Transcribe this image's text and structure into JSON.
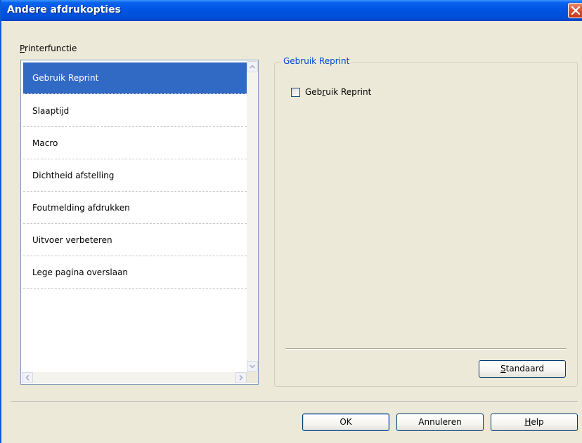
{
  "window": {
    "title": "Andere afdrukopties",
    "close_icon": "close-icon"
  },
  "printer_function": {
    "label_prefix": "P",
    "label_rest": "rinterfunctie",
    "items": [
      {
        "label": "Gebruik Reprint",
        "selected": true
      },
      {
        "label": "Slaaptijd"
      },
      {
        "label": "Macro"
      },
      {
        "label": "Dichtheid afstelling"
      },
      {
        "label": "Foutmelding afdrukken"
      },
      {
        "label": "Uitvoer verbeteren"
      },
      {
        "label": "Lege pagina overslaan"
      }
    ]
  },
  "group": {
    "legend": "Gebruik Reprint",
    "checkbox_pre": "Geb",
    "checkbox_mnemonic": "r",
    "checkbox_post": "uik Reprint",
    "checked": false,
    "standard_mnemonic": "S",
    "standard_rest": "tandaard"
  },
  "buttons": {
    "ok": "OK",
    "cancel": "Annuleren",
    "help_mnemonic": "H",
    "help_rest": "elp"
  },
  "colors": {
    "title_bar": "#0054e3",
    "selection": "#316ac5",
    "group_title": "#0046d5",
    "dialog_bg": "#ece9d8"
  }
}
